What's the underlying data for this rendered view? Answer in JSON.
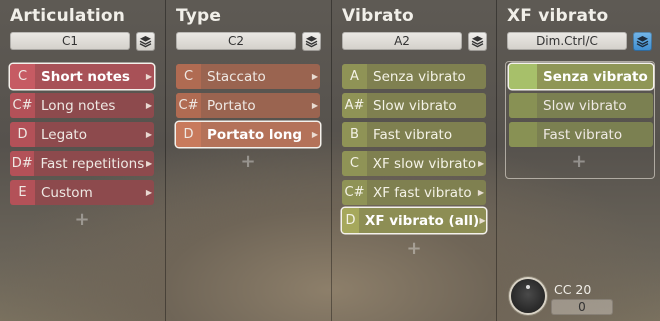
{
  "columns": [
    {
      "title": "Articulation",
      "select": "C1",
      "items": [
        {
          "note": "C",
          "label": "Short notes",
          "selected": true
        },
        {
          "note": "C#",
          "label": "Long notes"
        },
        {
          "note": "D",
          "label": "Legato"
        },
        {
          "note": "D#",
          "label": "Fast repetitions"
        },
        {
          "note": "E",
          "label": "Custom"
        }
      ],
      "add": "+"
    },
    {
      "title": "Type",
      "select": "C2",
      "items": [
        {
          "note": "C",
          "label": "Staccato"
        },
        {
          "note": "C#",
          "label": "Portato"
        },
        {
          "note": "D",
          "label": "Portato long",
          "selected": true
        }
      ],
      "add": "+"
    },
    {
      "title": "Vibrato",
      "select": "A2",
      "items": [
        {
          "note": "A",
          "label": "Senza vibrato"
        },
        {
          "note": "A#",
          "label": "Slow vibrato"
        },
        {
          "note": "B",
          "label": "Fast vibrato"
        },
        {
          "note": "C",
          "label": "XF slow vibrato"
        },
        {
          "note": "C#",
          "label": "XF fast vibrato"
        },
        {
          "note": "D",
          "label": "XF vibrato (all)",
          "selected": true
        }
      ],
      "add": "+"
    },
    {
      "title": "XF vibrato",
      "select": "Dim.Ctrl/C",
      "items": [
        {
          "label": "Senza vibrato",
          "selected": true
        },
        {
          "label": "Slow vibrato"
        },
        {
          "label": "Fast vibrato"
        }
      ],
      "add": "+",
      "cc": {
        "label": "CC 20",
        "value": "0"
      }
    }
  ],
  "icons": {
    "layer": "layers-icon",
    "arrow": "chevron-right-icon",
    "knob": "knob-icon"
  },
  "colors": {
    "articulation": "#b35158",
    "type": "#b06b52",
    "vibrato": "#8f9356",
    "xf": "#a7c06a",
    "active_layer_button": "#3e8dcf"
  }
}
